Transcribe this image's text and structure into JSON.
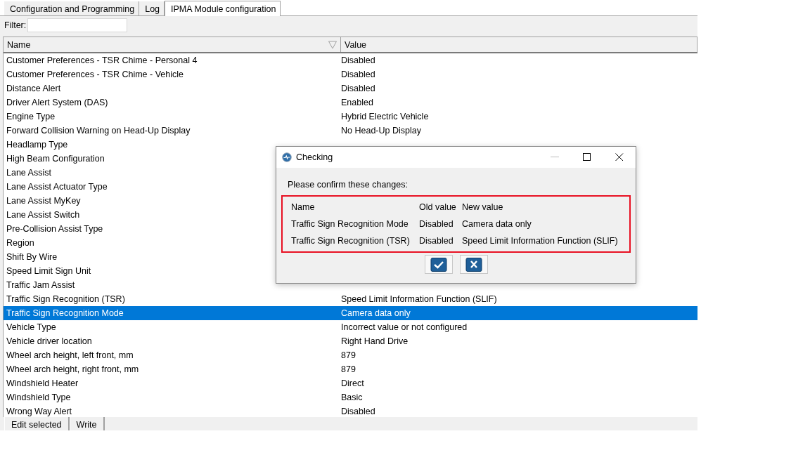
{
  "tabs": [
    {
      "label": "Configuration and Programming",
      "selected": false
    },
    {
      "label": "Log",
      "selected": false
    },
    {
      "label": "IPMA Module configuration",
      "selected": true
    }
  ],
  "filter": {
    "label": "Filter:"
  },
  "table": {
    "columns": [
      {
        "label": "Name",
        "sorted": true
      },
      {
        "label": "Value",
        "sorted": false
      }
    ],
    "rows": [
      {
        "name": "Customer Preferences - TSR Chime - Personal 4",
        "value": "Disabled",
        "selected": false
      },
      {
        "name": "Customer Preferences - TSR Chime - Vehicle",
        "value": "Disabled",
        "selected": false
      },
      {
        "name": "Distance Alert",
        "value": "Disabled",
        "selected": false
      },
      {
        "name": "Driver Alert System (DAS)",
        "value": "Enabled",
        "selected": false
      },
      {
        "name": "Engine Type",
        "value": "Hybrid Electric Vehicle",
        "selected": false
      },
      {
        "name": "Forward Collision Warning on Head-Up Display",
        "value": "No Head-Up Display",
        "selected": false
      },
      {
        "name": "Headlamp Type",
        "selected": false
      },
      {
        "name": "High Beam Configuration",
        "selected": false
      },
      {
        "name": "Lane Assist",
        "selected": false
      },
      {
        "name": "Lane Assist Actuator Type",
        "selected": false
      },
      {
        "name": "Lane Assist MyKey",
        "selected": false
      },
      {
        "name": "Lane Assist Switch",
        "selected": false
      },
      {
        "name": "Pre-Collision Assist Type",
        "selected": false
      },
      {
        "name": "Region",
        "selected": false
      },
      {
        "name": "Shift By Wire",
        "selected": false
      },
      {
        "name": "Speed Limit Sign Unit",
        "selected": false
      },
      {
        "name": "Traffic Jam Assist",
        "selected": false
      },
      {
        "name": "Traffic Sign Recognition (TSR)",
        "value": "Speed Limit Information Function (SLIF)",
        "selected": false
      },
      {
        "name": "Traffic Sign Recognition Mode",
        "value": "Camera data only",
        "selected": true
      },
      {
        "name": "Vehicle Type",
        "value": "Incorrect value or not configured",
        "selected": false
      },
      {
        "name": "Vehicle driver location",
        "value": "Right Hand Drive",
        "selected": false
      },
      {
        "name": "Wheel arch height, left front, mm",
        "value": "879",
        "selected": false
      },
      {
        "name": "Wheel arch height, right front, mm",
        "value": "879",
        "selected": false
      },
      {
        "name": "Windshield Heater",
        "value": "Direct",
        "selected": false
      },
      {
        "name": "Windshield Type",
        "value": "Basic",
        "selected": false
      },
      {
        "name": "Wrong Way Alert",
        "value": "Disabled",
        "selected": false
      }
    ]
  },
  "buttons": [
    "Edit selected",
    "Write"
  ],
  "dialog": {
    "title": "Checking",
    "message": "Please confirm these changes:",
    "columns": [
      "Name",
      "Old value",
      "New value"
    ],
    "rows": [
      [
        "Traffic Sign Recognition Mode",
        "Disabled",
        "Camera data only"
      ],
      [
        "Traffic Sign Recognition (TSR)",
        "Disabled",
        "Speed Limit Information Function (SLIF)"
      ]
    ]
  }
}
